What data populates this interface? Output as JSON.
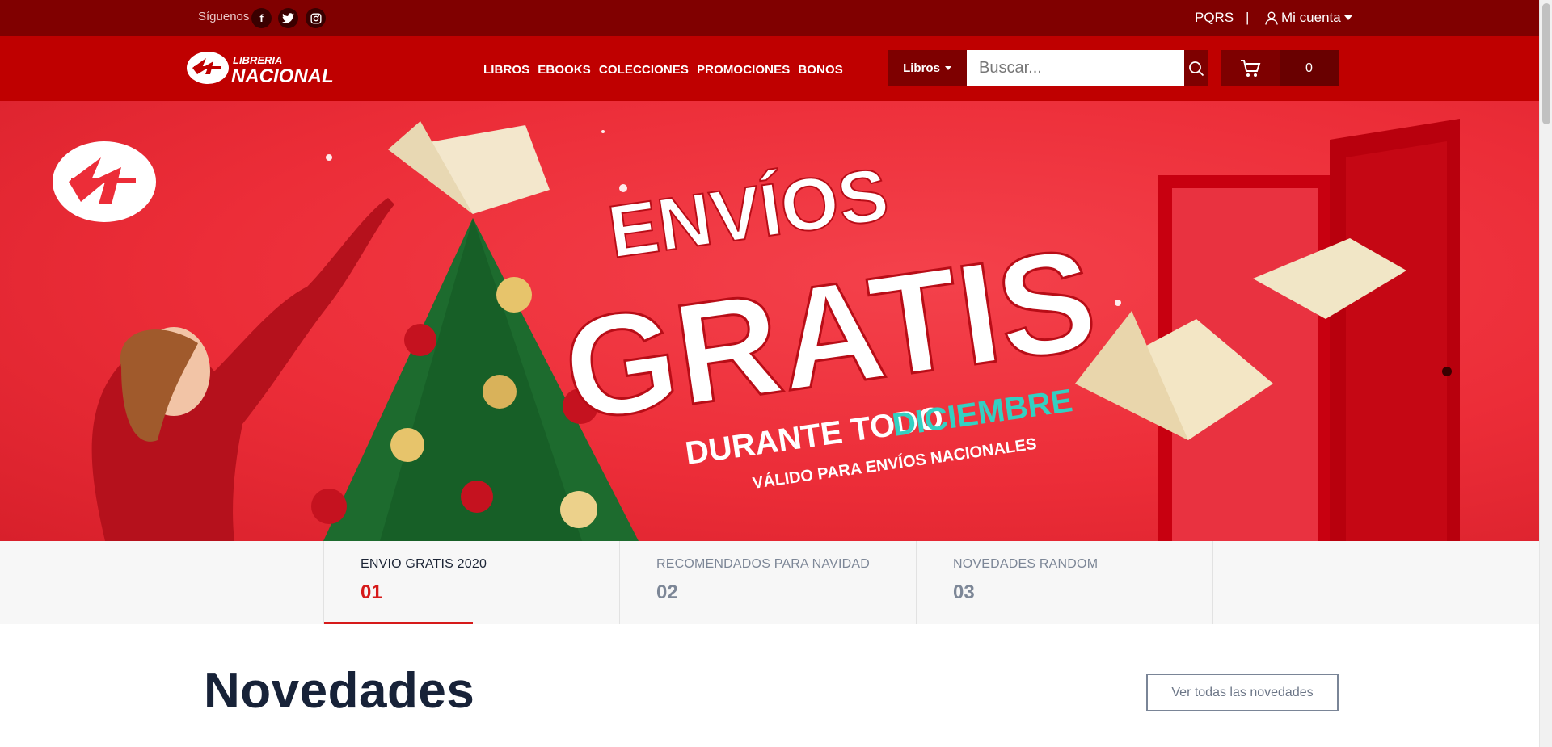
{
  "topbar": {
    "follow_label": "Síguenos",
    "socials": [
      {
        "name": "facebook",
        "glyph": "f"
      },
      {
        "name": "twitter",
        "glyph": "t"
      },
      {
        "name": "instagram",
        "glyph": "◎"
      }
    ],
    "pqrs": "PQRS",
    "separator": "|",
    "account": "Mi cuenta"
  },
  "navbar": {
    "logo_top": "LIBRERIA",
    "logo_bottom": "NACIONAL",
    "menu": [
      "LIBROS",
      "EBOOKS",
      "COLECCIONES",
      "PROMOCIONES",
      "BONOS"
    ],
    "category_select": "Libros",
    "search_placeholder": "Buscar...",
    "cart_count": "0"
  },
  "hero": {
    "line1": "ENVÍOS",
    "line2": "GRATIS",
    "line3a": "DURANTE TODO",
    "line3b": "DICIEMBRE",
    "line4": "VÁLIDO PARA ENVÍOS NACIONALES",
    "colors": {
      "background": "#ec2d38",
      "accent": "#34d0c2"
    }
  },
  "tabs": [
    {
      "title": "ENVIO GRATIS 2020",
      "number": "01",
      "active": true
    },
    {
      "title": "RECOMENDADOS PARA NAVIDAD",
      "number": "02",
      "active": false
    },
    {
      "title": "NOVEDADES RANDOM",
      "number": "03",
      "active": false
    }
  ],
  "section": {
    "title": "Novedades",
    "button": "Ver todas las novedades"
  }
}
